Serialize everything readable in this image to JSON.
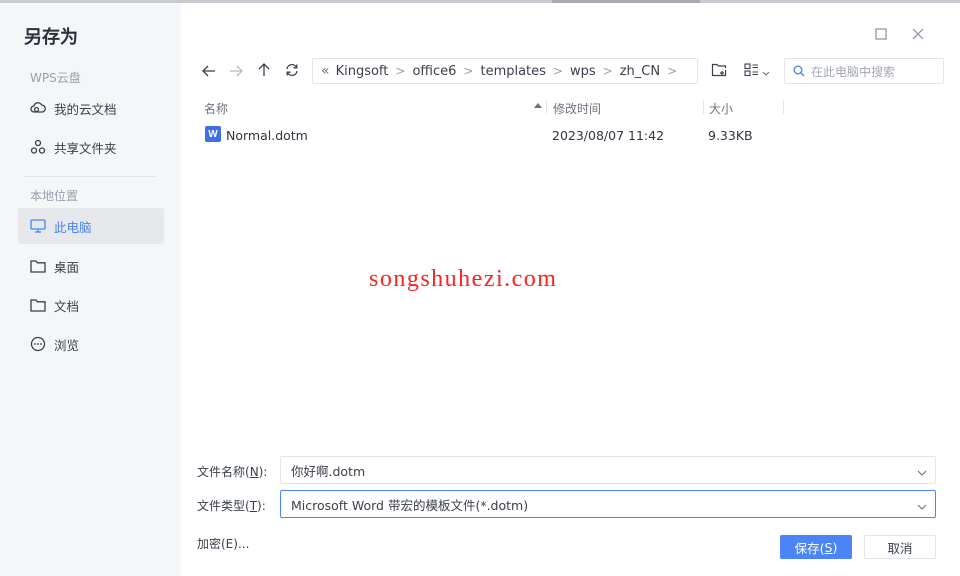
{
  "dialog": {
    "title": "另存为"
  },
  "sidebar": {
    "cloud_section": "WPS云盘",
    "local_section": "本地位置",
    "items": [
      {
        "label": "我的云文档",
        "icon": "cloud-icon"
      },
      {
        "label": "共享文件夹",
        "icon": "share-icon"
      },
      {
        "label": "此电脑",
        "icon": "monitor-icon",
        "active": true
      },
      {
        "label": "桌面",
        "icon": "folder-icon"
      },
      {
        "label": "文档",
        "icon": "folder-icon"
      },
      {
        "label": "浏览",
        "icon": "more-icon"
      }
    ]
  },
  "window": {
    "maximize": "maximize-icon",
    "close": "close-icon"
  },
  "toolbar": {
    "back": "arrow-left-icon",
    "forward": "arrow-right-icon",
    "up": "arrow-up-icon",
    "refresh": "refresh-icon",
    "breadcrumb_overflow": "«",
    "breadcrumb": [
      "Kingsoft",
      "office6",
      "templates",
      "wps",
      "zh_CN"
    ],
    "new_folder": "new-folder-icon",
    "view_mode": "view-list-icon",
    "search_placeholder": "在此电脑中搜索"
  },
  "file_list": {
    "columns": [
      "名称",
      "修改时间",
      "大小"
    ],
    "sort_column": "名称",
    "sort_direction": "ascending",
    "rows": [
      {
        "name": "Normal.dotm",
        "modified": "2023/08/07 11:42",
        "size": "9.33KB",
        "icon": "W"
      }
    ]
  },
  "watermark": "songshuhezi.com",
  "form": {
    "filename_label_pre": "文件名称(",
    "filename_label_key": "N",
    "filename_label_post": "):",
    "filename_value": "你好啊.dotm",
    "filetype_label_pre": "文件类型(",
    "filetype_label_key": "T",
    "filetype_label_post": "):",
    "filetype_value": "Microsoft Word 带宏的模板文件(*.dotm)",
    "encrypt_label": "加密(E)..."
  },
  "buttons": {
    "save_pre": "保存(",
    "save_key": "S",
    "save_post": ")",
    "cancel": "取消"
  },
  "colors": {
    "accent": "#4a84f5",
    "sidebar_bg": "#f5f6f8",
    "watermark": "#ff2020"
  }
}
